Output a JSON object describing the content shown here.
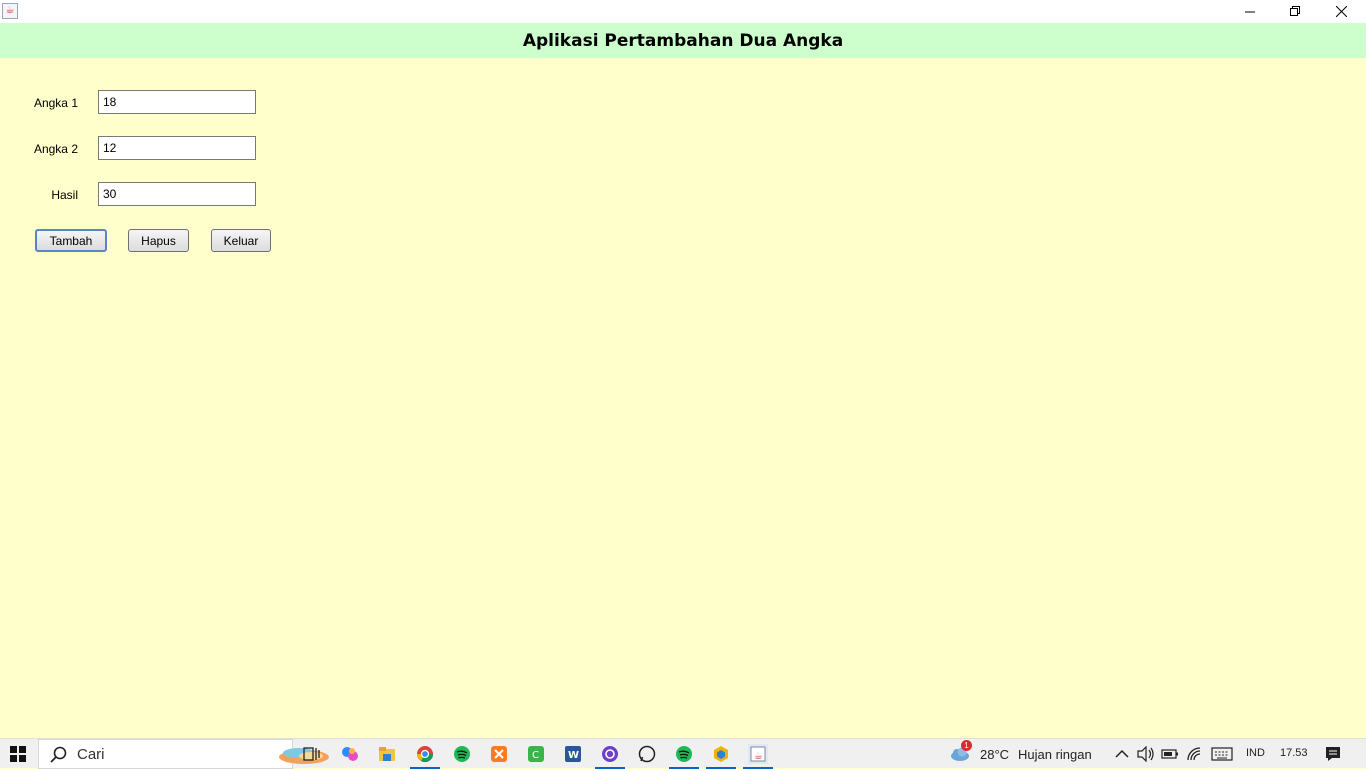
{
  "window": {
    "controls": [
      "minimize-icon",
      "maximize-icon",
      "close-icon"
    ]
  },
  "header": {
    "title": "Aplikasi Pertambahan Dua Angka"
  },
  "form": {
    "angka1_label": "Angka 1",
    "angka1_value": "18",
    "angka2_label": "Angka 2",
    "angka2_value": "12",
    "hasil_label": "Hasil",
    "hasil_value": "30"
  },
  "buttons": {
    "tambah": "Tambah",
    "hapus": "Hapus",
    "keluar": "Keluar"
  },
  "taskbar": {
    "search_placeholder": "Cari",
    "weather_temp": "28°C",
    "weather_desc": "Hujan ringan",
    "weather_badge": "1",
    "language": "IND",
    "time": "17.53"
  },
  "colors": {
    "background": "#ffffcc",
    "header": "#ccffcc"
  }
}
